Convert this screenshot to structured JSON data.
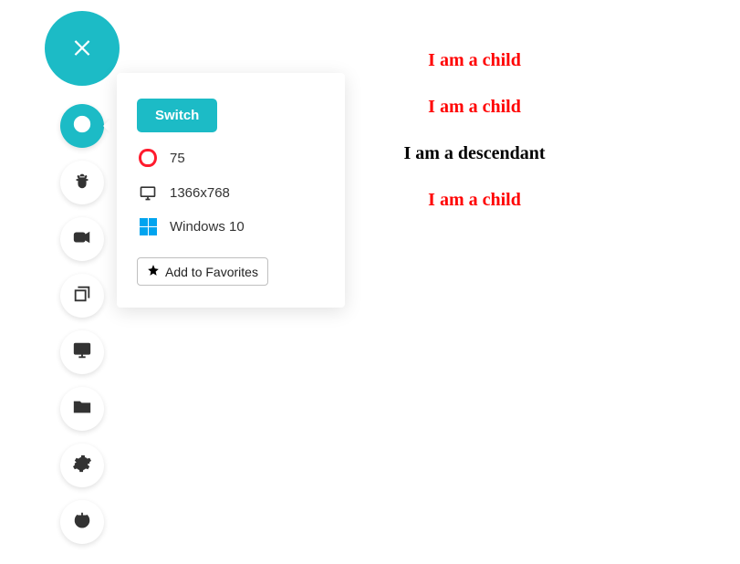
{
  "panel": {
    "switch_label": "Switch",
    "browser_label": "75",
    "resolution_label": "1366x768",
    "os_label": "Windows 10",
    "favorites_label": "Add to Favorites"
  },
  "sidebar": {
    "close_label": "Close",
    "items": [
      {
        "name": "switch"
      },
      {
        "name": "bug"
      },
      {
        "name": "record"
      },
      {
        "name": "screenshots"
      },
      {
        "name": "display"
      },
      {
        "name": "files"
      },
      {
        "name": "settings"
      },
      {
        "name": "power"
      }
    ]
  },
  "content": {
    "line1": "I am a child",
    "line2": "I am a child",
    "line3": "I am a descendant",
    "line4": "I am a child"
  },
  "colors": {
    "accent": "#1cbbc6",
    "child_text": "#ff0000",
    "descendant_text": "#000000"
  }
}
